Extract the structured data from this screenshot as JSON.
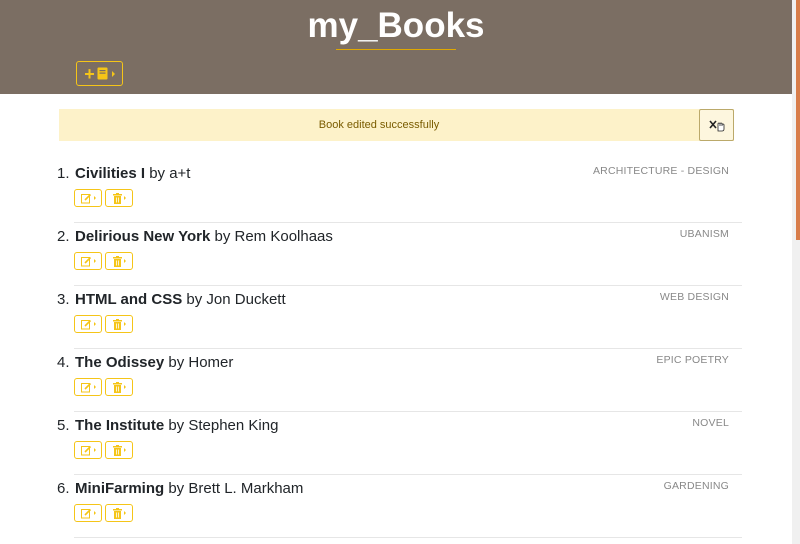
{
  "header": {
    "title": "my_Books",
    "add_button_icon": "plus-book-icon"
  },
  "alert": {
    "message": "Book edited successfully",
    "close_icon": "close-icon"
  },
  "colors": {
    "header_bg": "#7b6e63",
    "accent": "#f5c518",
    "alert_bg": "#fdf2c9"
  },
  "books": [
    {
      "num": "1.",
      "title": "Civilities I",
      "by": " by a+t",
      "category": "ARCHITECTURE - DESIGN"
    },
    {
      "num": "2.",
      "title": "Delirious New York",
      "by": " by Rem Koolhaas",
      "category": "UBANISM"
    },
    {
      "num": "3.",
      "title": "HTML and CSS",
      "by": " by Jon Duckett",
      "category": "WEB DESIGN"
    },
    {
      "num": "4.",
      "title": "The Odissey",
      "by": " by Homer",
      "category": "EPIC POETRY"
    },
    {
      "num": "5.",
      "title": "The Institute",
      "by": " by Stephen King",
      "category": "NOVEL"
    },
    {
      "num": "6.",
      "title": "MiniFarming",
      "by": " by Brett L. Markham",
      "category": "GARDENING"
    }
  ]
}
